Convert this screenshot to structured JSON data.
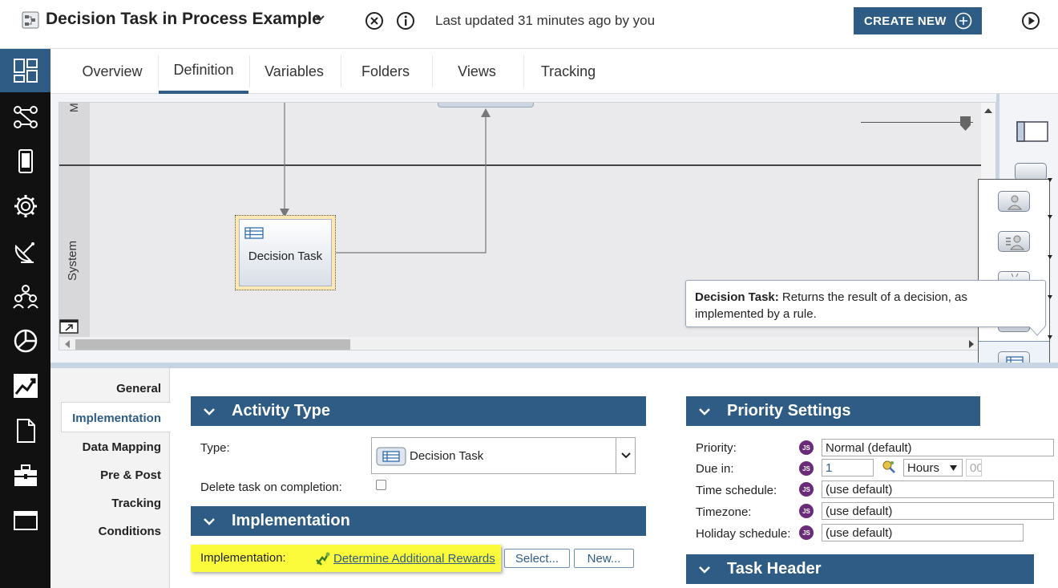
{
  "header": {
    "title": "Decision Task in Process Example",
    "last_updated": "Last updated 31 minutes ago by you",
    "create_new_label": "CREATE NEW"
  },
  "tabs": [
    {
      "label": "Overview"
    },
    {
      "label": "Definition"
    },
    {
      "label": "Variables"
    },
    {
      "label": "Folders"
    },
    {
      "label": "Views"
    },
    {
      "label": "Tracking"
    }
  ],
  "canvas": {
    "lane_top_label": "M",
    "lane_bottom_label": "System",
    "activity_label": "Decision Task"
  },
  "tooltip": {
    "title": "Decision Task:",
    "text": " Returns the result of a decision, as implemented by a rule."
  },
  "left_nav": [
    {
      "label": "General"
    },
    {
      "label": "Implementation"
    },
    {
      "label": "Data Mapping"
    },
    {
      "label": "Pre & Post"
    },
    {
      "label": "Tracking"
    },
    {
      "label": "Conditions"
    }
  ],
  "activity_type": {
    "header": "Activity Type",
    "type_label": "Type:",
    "type_value": "Decision Task",
    "delete_label": "Delete task on completion:"
  },
  "implementation": {
    "header": "Implementation",
    "label": "Implementation:",
    "link": "Determine Additional Rewards",
    "select_button": "Select...",
    "new_button": "New..."
  },
  "priority": {
    "header": "Priority Settings",
    "priority_label": "Priority:",
    "priority_value": "Normal (default)",
    "due_label": "Due in:",
    "due_value": "1",
    "due_unit": "Hours",
    "due_extra": "00",
    "time_schedule_label": "Time schedule:",
    "time_schedule_value": "(use default)",
    "timezone_label": "Timezone:",
    "timezone_value": "(use default)",
    "holiday_label": "Holiday schedule:",
    "holiday_value": "(use default)",
    "js_badge": "JS"
  },
  "task_header": {
    "header": "Task Header"
  },
  "colors": {
    "brand": "#2e5c84",
    "highlight": "#fbfb3b",
    "sidebar": "#111111"
  }
}
